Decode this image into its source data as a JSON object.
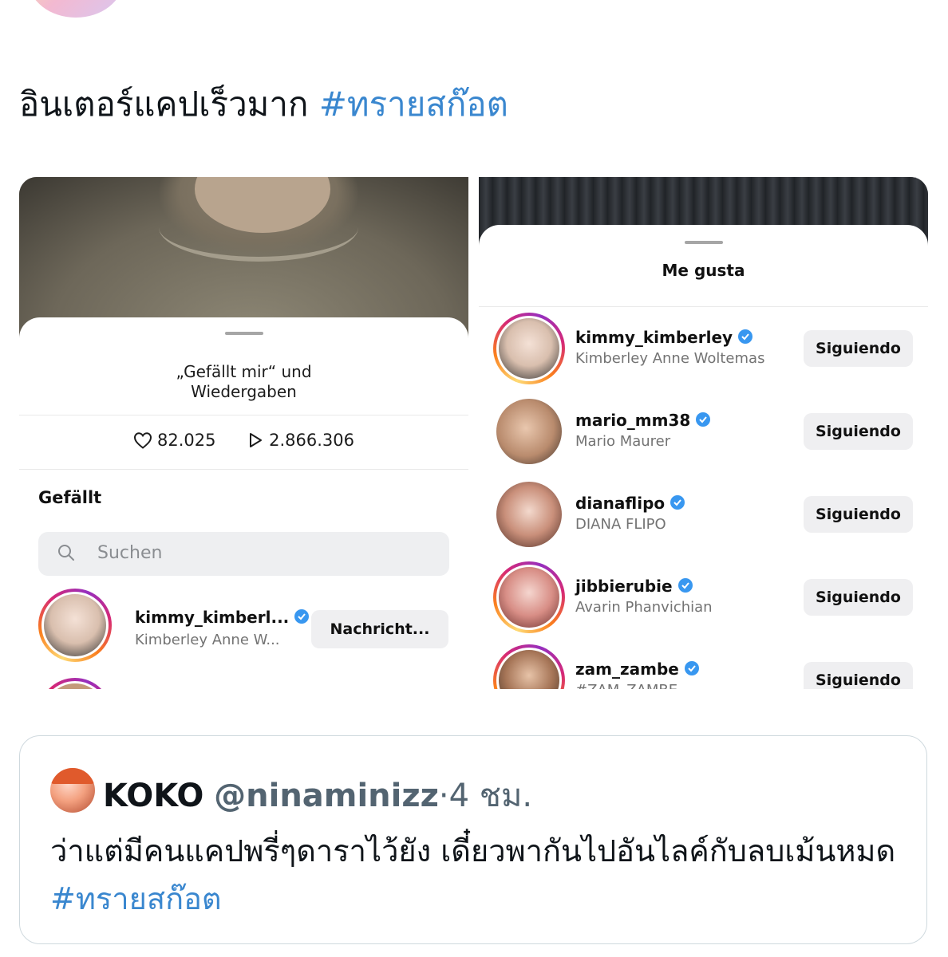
{
  "tweet": {
    "text": "อินเตอร์แคปเร็วมาก",
    "hashtag": "#ทรายสก๊อต"
  },
  "left_panel": {
    "title_line1": "„Gefällt mir“ und",
    "title_line2": "Wiedergaben",
    "likes": "82.025",
    "plays": "2.866.306",
    "section_title": "Gefällt",
    "search_placeholder": "Suchen",
    "row": {
      "username": "kimmy_kimberl...",
      "fullname": "Kimberley Anne W...",
      "button": "Nachricht..."
    }
  },
  "right_panel": {
    "title": "Me gusta",
    "rows": [
      {
        "username": "kimmy_kimberley",
        "fullname": "Kimberley Anne Woltemas",
        "button": "Siguiendo"
      },
      {
        "username": "mario_mm38",
        "fullname": "Mario Maurer",
        "button": "Siguiendo"
      },
      {
        "username": "dianaflipo",
        "fullname": "DIANA FLIPO",
        "button": "Siguiendo"
      },
      {
        "username": "jibbierubie",
        "fullname": "Avarin Phanvichian",
        "button": "Siguiendo"
      },
      {
        "username": "zam_zambe",
        "fullname": "#ZAM_ZAMBE",
        "button": "Siguiendo"
      }
    ]
  },
  "quote": {
    "name": "KOKO",
    "handle": "@ninaminizz",
    "separator": "·",
    "time": "4 ชม.",
    "text": "ว่าแต่มีคนแคปพรี่ๆดาราไว้ยัง เดี๋ยวพากันไปอันไลค์กับลบเม้นหมด",
    "hashtag": "#ทรายสก๊อต"
  },
  "colors": {
    "hashtag": "#3a87cf",
    "verified": "#3897f0",
    "button_bg": "#efeff1"
  }
}
